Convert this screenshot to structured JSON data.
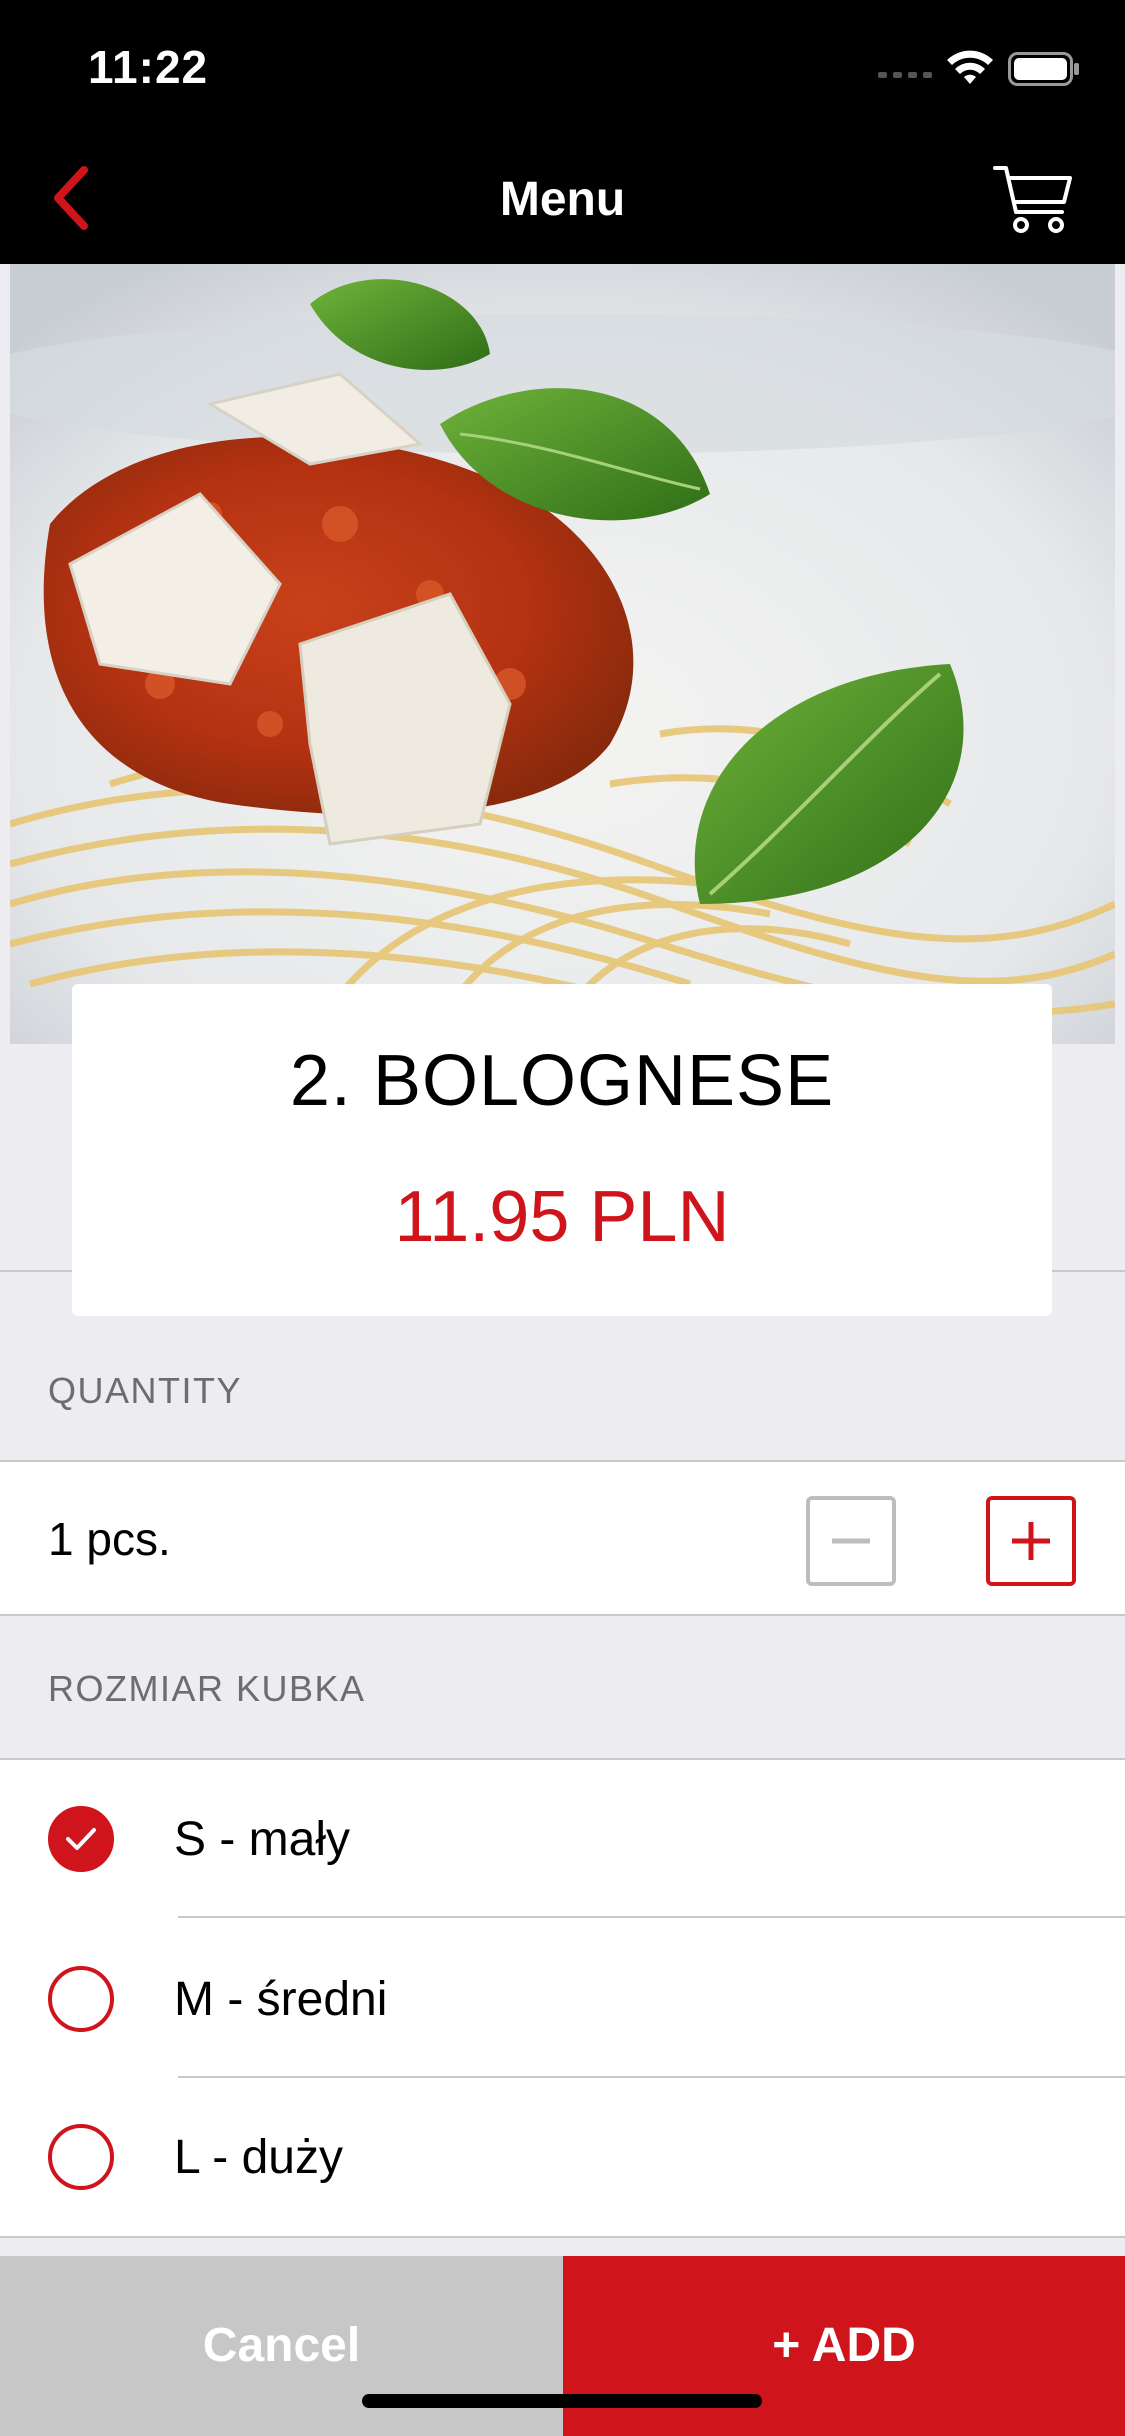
{
  "status_bar": {
    "time": "11:22",
    "icons": [
      "signal-icon",
      "wifi-icon",
      "battery-icon"
    ]
  },
  "nav": {
    "title": "Menu",
    "back_icon": "chevron-left-icon",
    "cart_icon": "cart-icon"
  },
  "product": {
    "image": "spaghetti-bolognese-photo",
    "name": "2. BOLOGNESE",
    "price": "11.95 PLN"
  },
  "quantity": {
    "section_label": "QUANTITY",
    "value_text": "1 pcs.",
    "minus_icon": "minus-icon",
    "plus_icon": "plus-icon"
  },
  "size": {
    "section_label": "ROZMIAR KUBKA",
    "options": [
      {
        "label": "S - mały",
        "checked": true
      },
      {
        "label": "M - średni",
        "checked": false
      },
      {
        "label": "L - duży",
        "checked": false
      }
    ]
  },
  "actions": {
    "cancel_label": "Cancel",
    "add_label": "+ ADD"
  },
  "colors": {
    "accent": "#D0141B",
    "background": "#ECECF1",
    "navbar": "#000000",
    "cancel_bg": "#C7C7C7"
  }
}
